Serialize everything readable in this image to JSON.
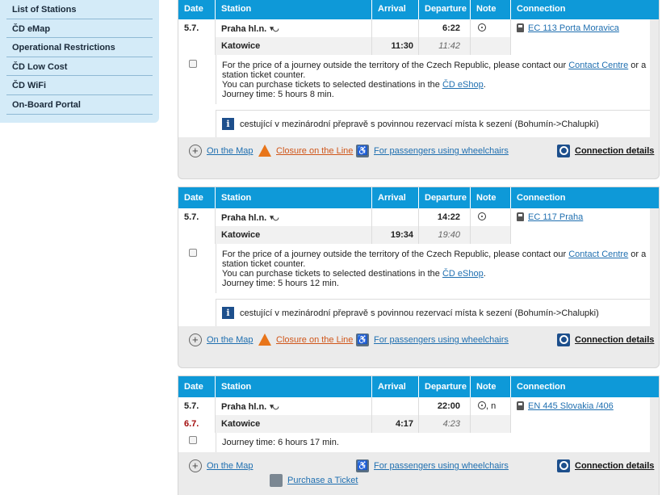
{
  "sidebar": {
    "items": [
      "List of Stations",
      "ČD eMap",
      "Operational Restrictions",
      "ČD Low Cost",
      "ČD WiFi",
      "On-Board Portal"
    ]
  },
  "headers": {
    "date": "Date",
    "station": "Station",
    "arrival": "Arrival",
    "departure": "Departure",
    "note": "Note",
    "connection": "Connection"
  },
  "footer_links": {
    "map": "On the Map",
    "closure": "Closure on the Line",
    "wheelchair": "For passengers using wheelchairs",
    "details": "Connection details",
    "ticket": "Purchase a Ticket"
  },
  "info": {
    "price_pre": "For the price of a journey outside the territory of the Czech Republic, please contact our",
    "contact_link": "Contact Centre",
    "price_post": "or a station ticket counter.",
    "eshop_pre": "You can purchase tickets to selected destinations in the",
    "eshop_link": "ČD eShop",
    "eshop_post": ".",
    "notice": "cestující v mezinárodní přepravě s povinnou rezervací místa k sezení (Bohumín->Chalupki)"
  },
  "connections": [
    {
      "from": {
        "date": "5.7.",
        "station": "Praha hl.n.",
        "departure": "6:22"
      },
      "to": {
        "station": "Katowice",
        "arrival": "11:30",
        "departure": "11:42"
      },
      "train": "EC 113 Porta Moravica",
      "journey_time": "Journey time: 5 hours 8 min."
    },
    {
      "from": {
        "date": "5.7.",
        "station": "Praha hl.n.",
        "departure": "14:22"
      },
      "to": {
        "station": "Katowice",
        "arrival": "19:34",
        "departure": "19:40"
      },
      "train": "EC 117 Praha",
      "journey_time": "Journey time: 5 hours 12 min."
    },
    {
      "from": {
        "date": "5.7.",
        "station": "Praha hl.n.",
        "departure": "22:00",
        "note_suffix": ", n"
      },
      "to": {
        "date": "6.7.",
        "station": "Katowice",
        "arrival": "4:17",
        "departure": "4:23"
      },
      "train": "EN 445 Slovakia /406",
      "journey_time": "Journey time: 6 hours 17 min."
    }
  ]
}
